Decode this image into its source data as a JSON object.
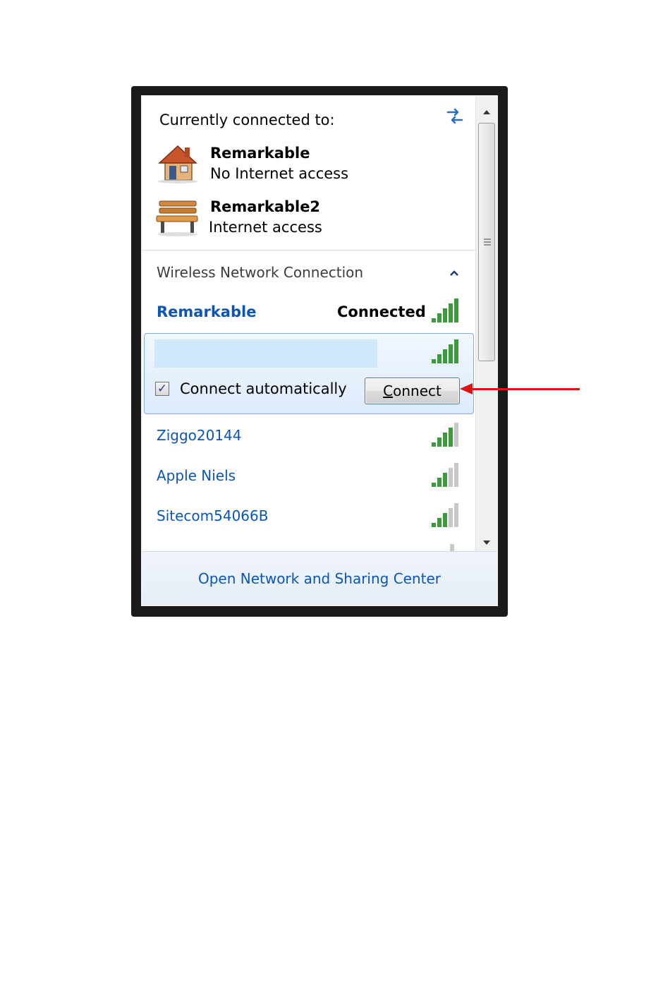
{
  "header": {
    "title": "Currently connected to:",
    "refresh_icon": "refresh-arrows-icon"
  },
  "connections": [
    {
      "name": "Remarkable",
      "status": "No Internet access",
      "icon": "home-network-icon"
    },
    {
      "name": "Remarkable2",
      "status": "Internet access",
      "icon": "public-network-bench-icon"
    }
  ],
  "wireless": {
    "section_title": "Wireless Network Connection",
    "connected_network": {
      "name": "Remarkable",
      "status": "Connected",
      "signal": 5
    },
    "selected_network": {
      "name": "",
      "signal": 5,
      "connect_auto_label": "Connect automatically",
      "connect_auto_checked": true,
      "connect_button": {
        "accel": "C",
        "rest": "onnect"
      }
    },
    "networks": [
      {
        "name": "Ziggo20144",
        "signal": 4
      },
      {
        "name": "Apple Niels",
        "signal": 3
      },
      {
        "name": "Sitecom54066B",
        "signal": 3
      }
    ]
  },
  "footer": {
    "link": "Open Network and Sharing Center"
  },
  "colors": {
    "link": "#0b55b5",
    "signal_green": "#3c9a3c",
    "signal_gray": "#c8c8c8",
    "annotation_arrow": "#e0120c"
  }
}
